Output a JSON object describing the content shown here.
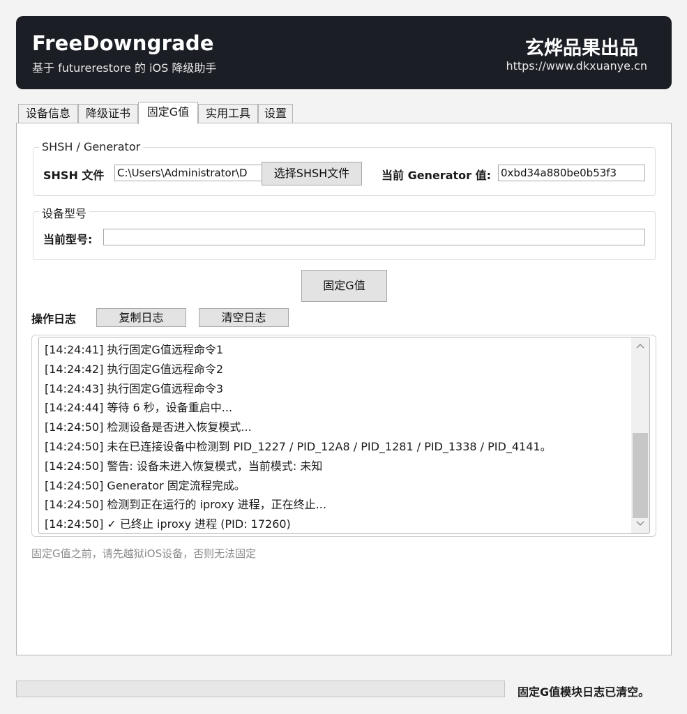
{
  "header": {
    "title": "FreeDowngrade",
    "subtitle": "基于 futurerestore 的 iOS 降级助手",
    "brand": "玄烨品果出品",
    "url": "https://www.dkxuanye.cn",
    "background_color": "#1c1e26"
  },
  "tabs": [
    {
      "label": "设备信息",
      "active": false
    },
    {
      "label": "降级证书",
      "active": false
    },
    {
      "label": "固定G值",
      "active": true
    },
    {
      "label": "实用工具",
      "active": false
    },
    {
      "label": "设置",
      "active": false
    }
  ],
  "shsh_group": {
    "title": "SHSH / Generator",
    "file_label": "SHSH 文件",
    "file_value": "C:\\Users\\Administrator\\D",
    "choose_button": "选择SHSH文件",
    "generator_label": "当前 Generator 值:",
    "generator_value": "0xbd34a880be0b53f3"
  },
  "model_group": {
    "title": "设备型号",
    "model_label": "当前型号:",
    "model_value": ""
  },
  "action_button": "固定G值",
  "log": {
    "title": "操作日志",
    "copy_button": "复制日志",
    "clear_button": "清空日志",
    "lines": [
      "[14:24:41] 执行固定G值远程命令1",
      "[14:24:42] 执行固定G值远程命令2",
      "[14:24:43] 执行固定G值远程命令3",
      "[14:24:44] 等待 6 秒，设备重启中...",
      "[14:24:50] 检测设备是否进入恢复模式...",
      "[14:24:50] 未在已连接设备中检测到 PID_1227 / PID_12A8 / PID_1281 / PID_1338 / PID_4141。",
      "[14:24:50] 警告: 设备未进入恢复模式，当前模式: 未知",
      "[14:24:50] Generator 固定流程完成。",
      "[14:24:50] 检测到正在运行的 iproxy 进程，正在终止...",
      "[14:24:50] ✓ 已终止 iproxy 进程 (PID: 17260)"
    ]
  },
  "hint": "固定G值之前，请先越狱iOS设备，否则无法固定",
  "status": {
    "progress": 0,
    "message": "固定G值模块日志已清空。"
  },
  "icons": {
    "scroll_up": "chevron-up-icon",
    "scroll_down": "chevron-down-icon"
  }
}
